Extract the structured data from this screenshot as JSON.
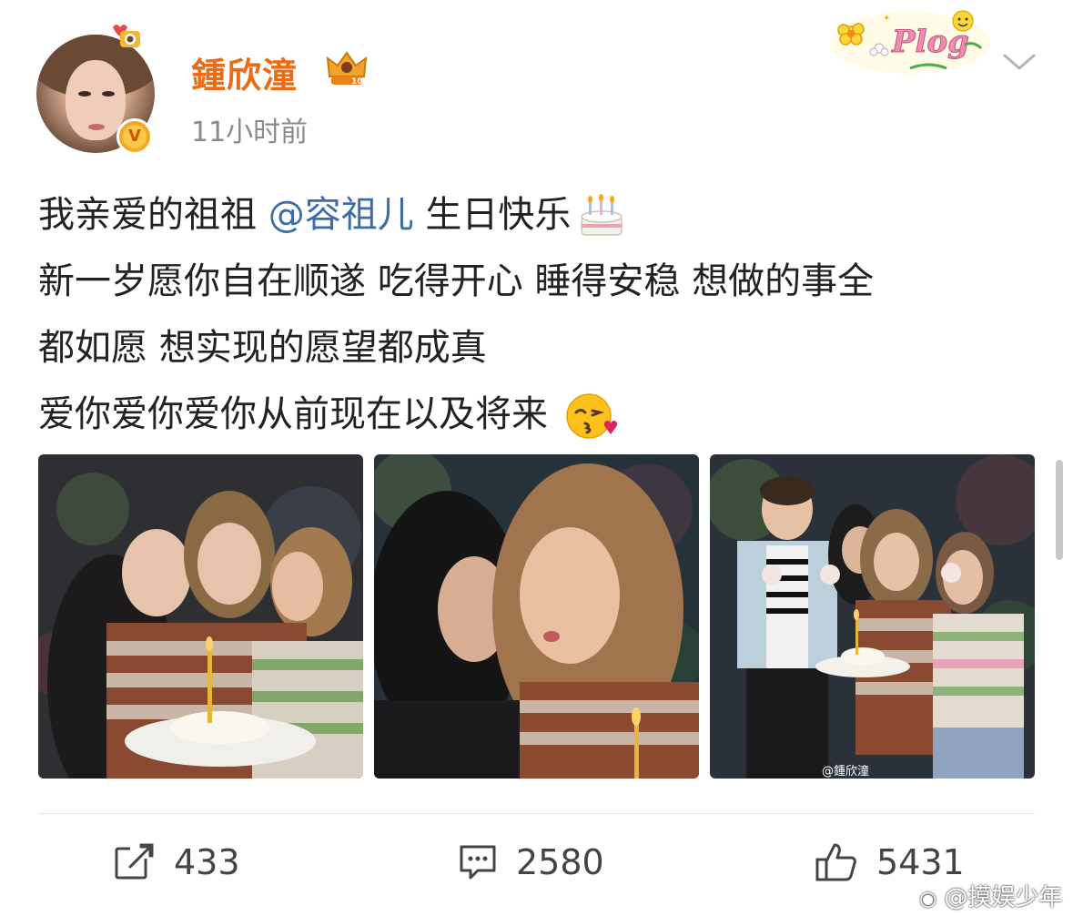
{
  "header": {
    "username": "鍾欣潼",
    "time": "11小时前",
    "verified_badge": "V",
    "member_badge": "10",
    "sticker_text": "Plog"
  },
  "post": {
    "line1_pre": "我亲爱的祖祖 ",
    "mention": "@容祖儿",
    "line1_post": " 生日快乐",
    "line2": "新一岁愿你自在顺遂 吃得开心 睡得安稳 想做的事全",
    "line3": "都如愿 想实现的愿望都成真",
    "line4": "爱你爱你爱你从前现在以及将来 ",
    "emoji1": "cake-emoji",
    "emoji2": "kiss-emoji"
  },
  "photos": {
    "watermark": "@鍾欣潼"
  },
  "actions": {
    "repost_count": "433",
    "comment_count": "2580",
    "like_count": "5431"
  },
  "source_watermark": "@摸娱少年",
  "colors": {
    "username": "#ec6b16",
    "mention": "#3e6ca8",
    "time": "#8a8a8a",
    "badge": "#f5a623"
  }
}
